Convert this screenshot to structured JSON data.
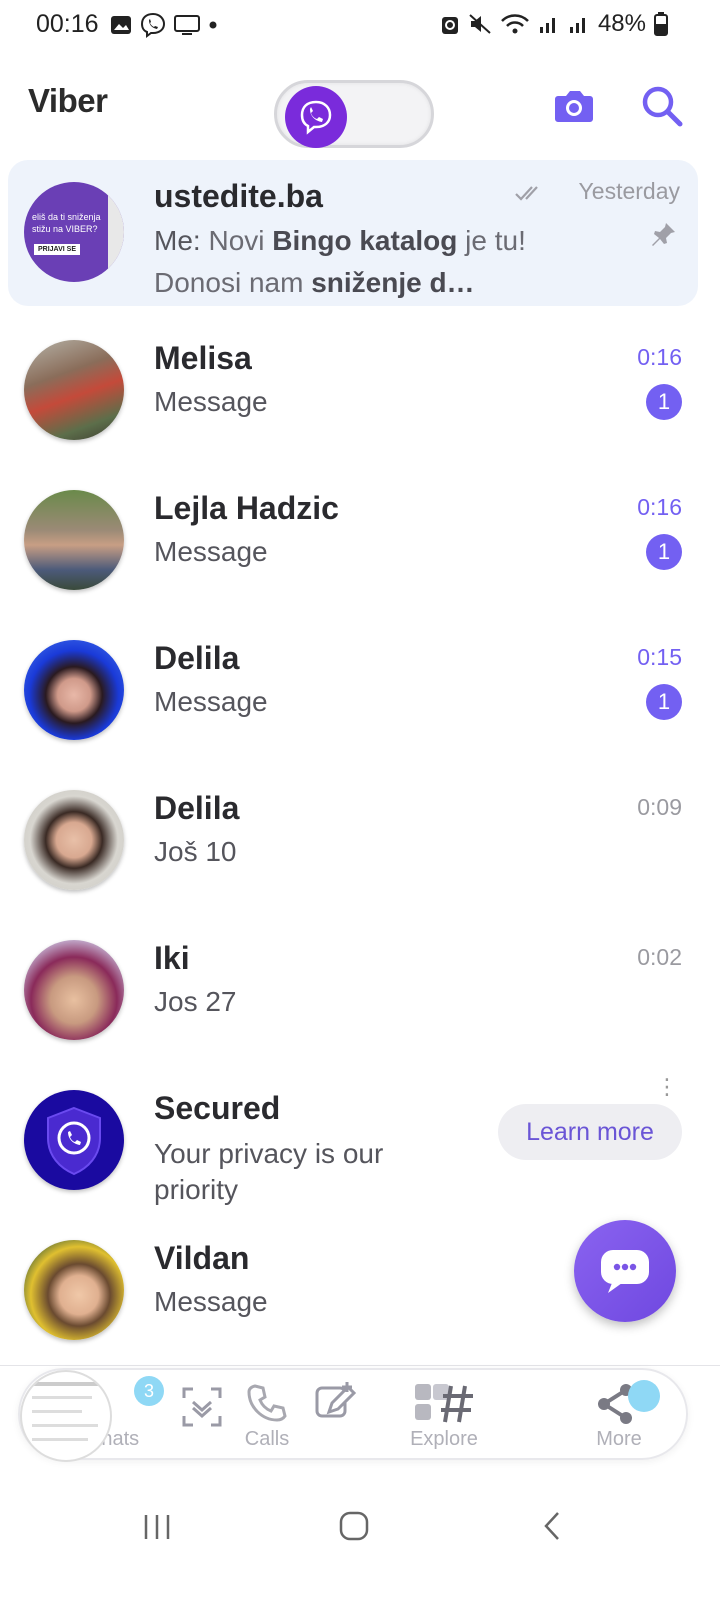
{
  "status_bar": {
    "time": "00:16",
    "battery": "48%"
  },
  "header": {
    "app_name": "Viber"
  },
  "chats": [
    {
      "name": "ustedite.ba",
      "message_prefix": "Me: ",
      "message_parts": [
        "Novi ",
        "Bingo katalog",
        " je tu! Donosi nam ",
        "sniženje d…"
      ],
      "time": "Yesterday",
      "pinned": true,
      "avatar_text_1": "eliš da ti sniženja",
      "avatar_text_2": "stižu na VIBER?",
      "avatar_button": "PRIJAVI SE"
    },
    {
      "name": "Melisa",
      "message": "Message",
      "time": "0:16",
      "unread": "1"
    },
    {
      "name": "Lejla Hadzic",
      "message": "Message",
      "time": "0:16",
      "unread": "1"
    },
    {
      "name": "Delila",
      "message": "Message",
      "time": "0:15",
      "unread": "1"
    },
    {
      "name": "Delila",
      "message": "Još 10",
      "time": "0:09"
    },
    {
      "name": "Iki",
      "message": "Jos 27",
      "time": "0:02"
    },
    {
      "name": "Secured",
      "message": "Your privacy is our priority",
      "action": "Learn more"
    },
    {
      "name": "Vildan",
      "message": "Message"
    }
  ],
  "bottom_nav": {
    "chats": "Chats",
    "chats_badge": "3",
    "calls": "Calls",
    "explore": "Explore",
    "more": "More"
  },
  "colors": {
    "accent": "#7360f2",
    "brand_purple": "#7a2bdb",
    "pinned_bg": "#eef3fb"
  }
}
